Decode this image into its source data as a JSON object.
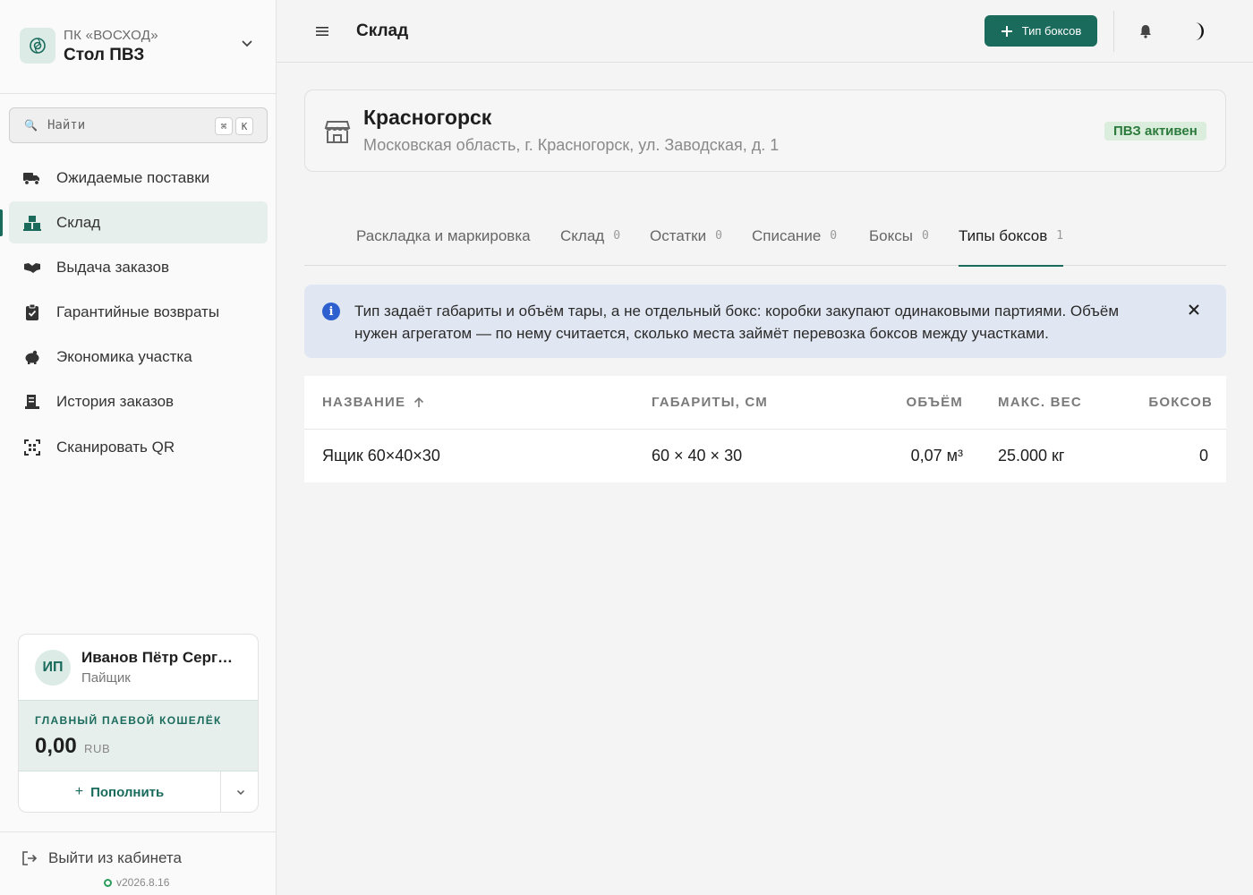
{
  "org": {
    "subtitle": "ПК «ВОСХОД»",
    "name": "Стол ПВЗ"
  },
  "search": {
    "placeholder": "Найти",
    "shortcut_mod": "⌘",
    "shortcut_key": "K"
  },
  "nav": {
    "items": [
      {
        "label": "Ожидаемые поставки",
        "icon": "truck-icon",
        "active": false
      },
      {
        "label": "Склад",
        "icon": "boxes-icon",
        "active": true
      },
      {
        "label": "Выдача заказов",
        "icon": "handshake-icon",
        "active": false
      },
      {
        "label": "Гарантийные возвраты",
        "icon": "clipboard-check-icon",
        "active": false
      },
      {
        "label": "Экономика участка",
        "icon": "piggy-bank-icon",
        "active": false
      },
      {
        "label": "История заказов",
        "icon": "receipt-icon",
        "active": false
      },
      {
        "label": "Сканировать QR",
        "icon": "qr-scan-icon",
        "active": false
      }
    ]
  },
  "user": {
    "initials": "ИП",
    "name": "Иванов Пётр Сергеевич",
    "role": "Пайщик"
  },
  "wallet": {
    "label": "ГЛАВНЫЙ ПАЕВОЙ КОШЕЛЁК",
    "amount": "0,00",
    "currency": "RUB",
    "topup_label": "Пополнить"
  },
  "logout": {
    "label": "Выйти из кабинета",
    "version": "v2026.8.16"
  },
  "header": {
    "title": "Склад",
    "add_button": "Тип боксов"
  },
  "location": {
    "city": "Красногорск",
    "address": "Московская область, г. Красногорск, ул. Заводская, д. 1",
    "status": "ПВЗ активен"
  },
  "tabs": [
    {
      "label": "Раскладка и маркировка",
      "count": "",
      "active": false
    },
    {
      "label": "Склад",
      "count": "0",
      "active": false
    },
    {
      "label": "Остатки",
      "count": "0",
      "active": false
    },
    {
      "label": "Списание",
      "count": "0",
      "active": false
    },
    {
      "label": "Боксы",
      "count": "0",
      "active": false
    },
    {
      "label": "Типы боксов",
      "count": "1",
      "active": true
    }
  ],
  "info": {
    "text": "Тип задаёт габариты и объём тары, а не отдельный бокс: коробки закупают одинаковыми партиями. Объём нужен агрегатом — по нему считается, сколько места займёт перевозка боксов между участками."
  },
  "table": {
    "columns": [
      "НАЗВАНИЕ",
      "ГАБАРИТЫ, СМ",
      "ОБЪЁМ",
      "МАКС. ВЕС",
      "БОКСОВ"
    ],
    "sort_column": "НАЗВАНИЕ",
    "sort_direction": "asc",
    "rows": [
      {
        "name": "Ящик 60×40×30",
        "dims": "60 × 40 × 30",
        "volume": "0,07 м³",
        "max_weight": "25.000 кг",
        "count": "0"
      }
    ]
  },
  "colors": {
    "accent": "#1a6b5c",
    "info_bg": "#e1e7f2",
    "status_bg": "#dbeedd",
    "status_text": "#2c7a3c"
  }
}
